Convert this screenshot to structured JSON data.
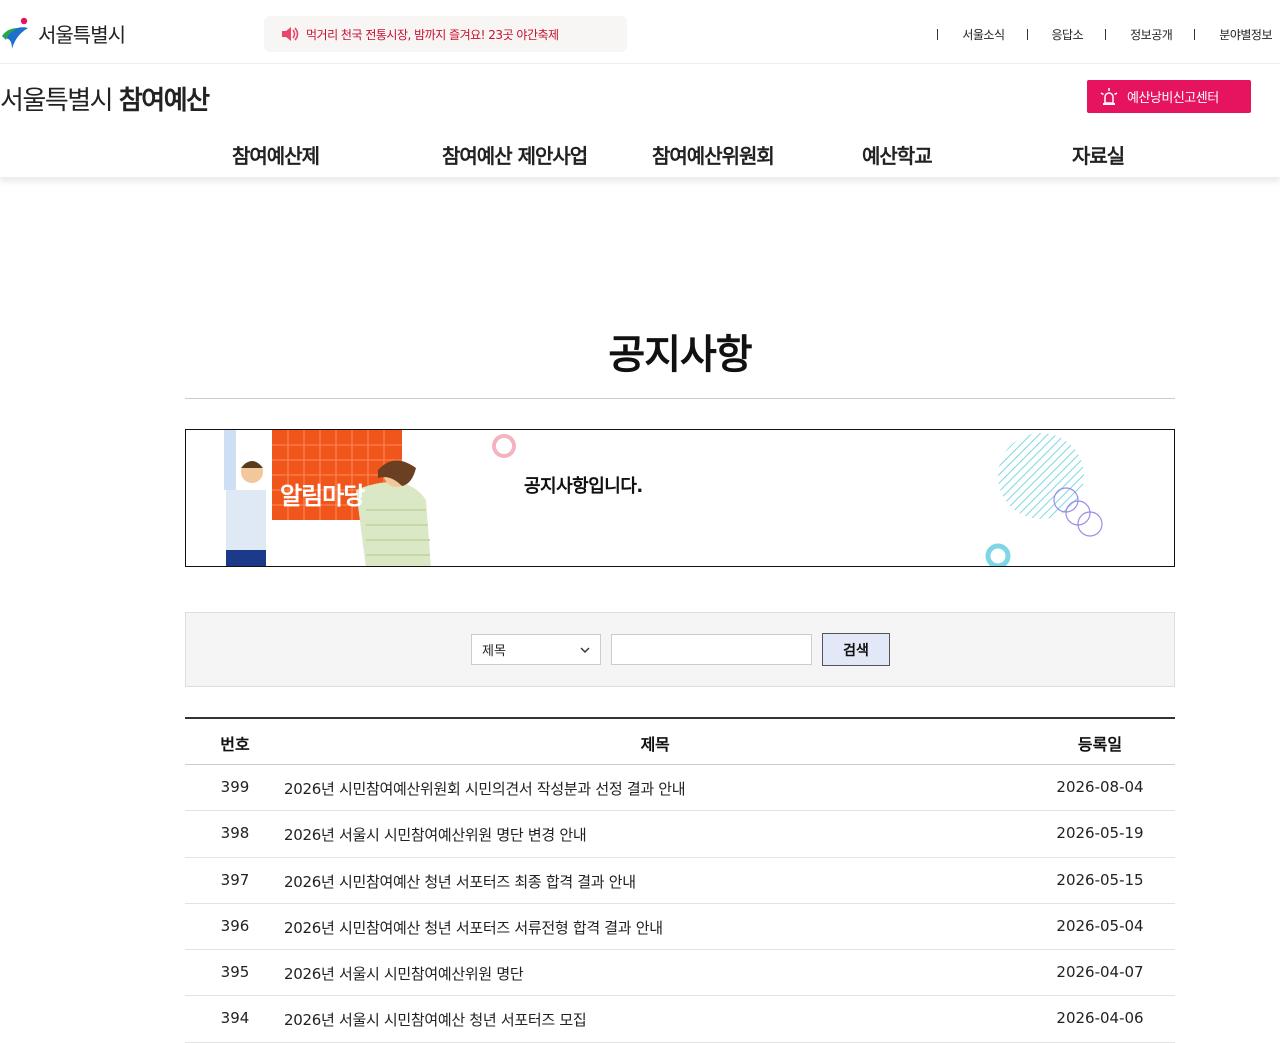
{
  "header": {
    "logo_text": "서울특별시",
    "notice": "먹거리 천국 전통시장, 밤까지 즐겨요! 23곳 야간축제",
    "utility_links": [
      "서울소식",
      "응답소",
      "정보공개",
      "분야별정보"
    ]
  },
  "site": {
    "title_light": "서울특별시 ",
    "title_bold": "참여예산",
    "report_button": "예산낭비신고센터"
  },
  "gnb": [
    "참여예산제",
    "참여예산 제안사업",
    "참여예산위원회",
    "예산학교",
    "자료실"
  ],
  "page": {
    "title": "공지사항",
    "banner_text": "공지사항입니다.",
    "banner_image_label": "알림마당"
  },
  "search": {
    "select_value": "제목",
    "input_value": "",
    "button_label": "검색"
  },
  "table": {
    "headers": {
      "no": "번호",
      "title": "제목",
      "date": "등록일"
    },
    "rows": [
      {
        "no": "399",
        "title": "2026년 시민참여예산위원회 시민의견서 작성분과 선정 결과 안내",
        "date": "2026-08-04"
      },
      {
        "no": "398",
        "title": "2026년 서울시 시민참여예산위원 명단 변경 안내",
        "date": "2026-05-19"
      },
      {
        "no": "397",
        "title": "2026년 시민참여예산 청년 서포터즈 최종 합격 결과 안내",
        "date": "2026-05-15"
      },
      {
        "no": "396",
        "title": "2026년 시민참여예산 청년 서포터즈 서류전형 합격 결과 안내",
        "date": "2026-05-04"
      },
      {
        "no": "395",
        "title": "2026년 서울시 시민참여예산위원 명단",
        "date": "2026-04-07"
      },
      {
        "no": "394",
        "title": "2026년 서울시 시민참여예산 청년 서포터즈 모집",
        "date": "2026-04-06"
      }
    ]
  },
  "colors": {
    "accent": "#e6135f",
    "notice_text": "#c8102e",
    "banner_orange": "#f0561c"
  }
}
